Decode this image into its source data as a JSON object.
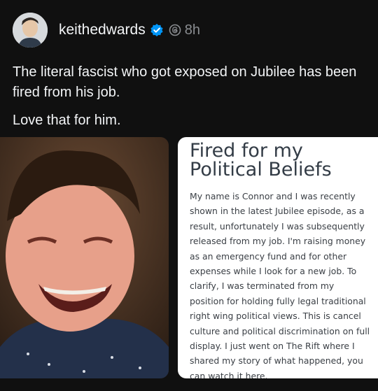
{
  "post": {
    "username": "keithedwards",
    "time": "8h",
    "text_line1": "The literal fascist who got exposed on Jubilee has been fired from his job.",
    "text_line2": "Love that for him."
  },
  "icons": {
    "verified": "verified-badge-icon",
    "threads": "threads-icon"
  },
  "card": {
    "title": "Fired for my Political Beliefs",
    "body": "My name is Connor and I was recently shown in the latest Jubilee episode, as a result, unfortunately I was subsequently released from my job. I'm raising money as an emergency fund and for other expenses while I look for a new job. To clarify, I was terminated from my position for holding fully legal traditional right wing political views. This is cancel culture and political discrimination on full display. I just went on The Rift where I shared my story of what happened, you can watch it here."
  },
  "colors": {
    "background": "#101010",
    "text": "#f3f5f7",
    "muted": "#8a8d91",
    "verified": "#0095f6"
  }
}
